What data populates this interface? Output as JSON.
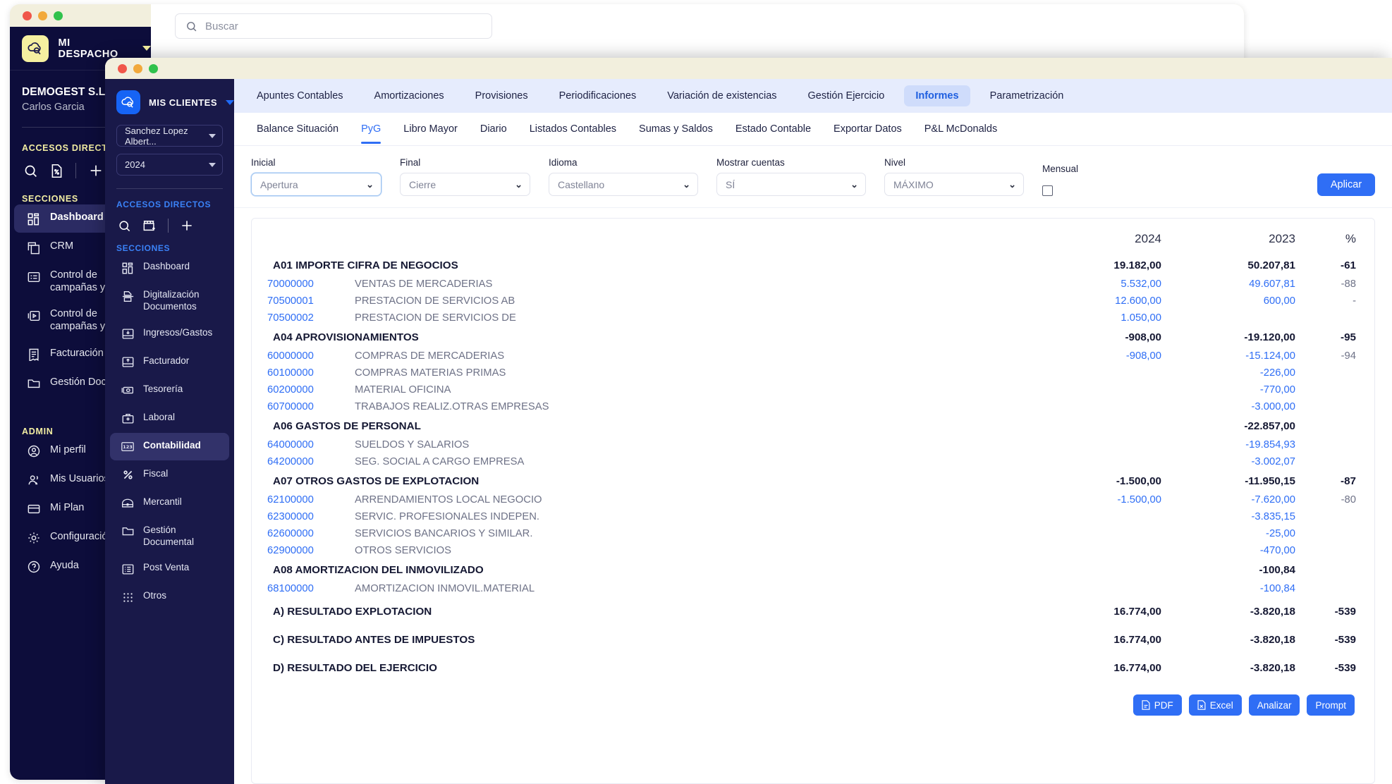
{
  "back_window": {
    "brand": {
      "name": "MI DESPACHO",
      "logo_icon": "cloud-search-icon",
      "caret_icon": "chevron-down-icon"
    },
    "search": {
      "placeholder": "Buscar",
      "icon": "search-icon"
    },
    "org": {
      "name": "DEMOGEST S.L",
      "user": "Carlos Garcia"
    },
    "shortcuts": {
      "title": "ACCESOS DIRECTOS",
      "icons": [
        "search-icon",
        "document-percent-icon",
        "plus-icon"
      ]
    },
    "sections": {
      "title": "SECCIONES",
      "items": [
        {
          "label": "Dashboard",
          "icon": "dashboard-icon",
          "active": true
        },
        {
          "label": "CRM",
          "icon": "copy-icon",
          "active": false
        },
        {
          "label": "Control de campañas y NE",
          "icon": "window-list-icon",
          "active": false
        },
        {
          "label": "Control de campañas y NE",
          "icon": "media-box-icon",
          "active": false
        },
        {
          "label": "Facturación",
          "icon": "invoice-icon",
          "active": false
        },
        {
          "label": "Gestión Docum",
          "icon": "folder-icon",
          "active": false
        }
      ]
    },
    "admin": {
      "title": "ADMIN",
      "items": [
        {
          "label": "Mi perfil",
          "icon": "user-circle-icon"
        },
        {
          "label": "Mis Usuarios",
          "icon": "users-icon"
        },
        {
          "label": "Mi Plan",
          "icon": "card-icon"
        },
        {
          "label": "Configuración",
          "icon": "gear-icon"
        },
        {
          "label": "Ayuda",
          "icon": "help-circle-icon"
        }
      ]
    }
  },
  "front_window": {
    "sidebar": {
      "brand": {
        "name": "MIS CLIENTES",
        "logo_icon": "cloud-search-icon",
        "caret_icon": "chevron-down-icon"
      },
      "client_select": {
        "value": "Sanchez Lopez Albert...",
        "caret_icon": "chevron-down-icon"
      },
      "year_select": {
        "value": "2024",
        "caret_icon": "chevron-down-icon"
      },
      "shortcuts": {
        "title": "ACCESOS DIRECTOS",
        "icons": [
          "search-icon",
          "store-add-icon",
          "plus-icon"
        ]
      },
      "sections": {
        "title": "SECCIONES",
        "items": [
          {
            "label": "Dashboard",
            "icon": "dashboard-icon",
            "active": false
          },
          {
            "label": "Digitalización Documentos",
            "icon": "scan-doc-icon",
            "active": false
          },
          {
            "label": "Ingresos/Gastos",
            "icon": "inbox-down-icon",
            "active": false
          },
          {
            "label": "Facturador",
            "icon": "inbox-up-icon",
            "active": false
          },
          {
            "label": "Tesorería",
            "icon": "money-icon",
            "active": false
          },
          {
            "label": "Laboral",
            "icon": "briefcase-icon",
            "active": false
          },
          {
            "label": "Contabilidad",
            "icon": "numbers-123-icon",
            "active": true
          },
          {
            "label": "Fiscal",
            "icon": "percent-icon",
            "active": false
          },
          {
            "label": "Mercantil",
            "icon": "toolbox-icon",
            "active": false
          },
          {
            "label": "Gestión Documental",
            "icon": "folder-icon",
            "active": false
          },
          {
            "label": "Post Venta",
            "icon": "list-box-icon",
            "active": false
          },
          {
            "label": "Otros",
            "icon": "grid-dots-icon",
            "active": false
          }
        ]
      }
    },
    "topnav": {
      "tabs": [
        {
          "label": "Apuntes Contables",
          "active": false
        },
        {
          "label": "Amortizaciones",
          "active": false
        },
        {
          "label": "Provisiones",
          "active": false
        },
        {
          "label": "Periodificaciones",
          "active": false
        },
        {
          "label": "Variación de existencias",
          "active": false
        },
        {
          "label": "Gestión Ejercicio",
          "active": false
        },
        {
          "label": "Informes",
          "active": true
        },
        {
          "label": "Parametrización",
          "active": false
        }
      ]
    },
    "subnav": {
      "tabs": [
        {
          "label": "Balance Situación",
          "active": false
        },
        {
          "label": "PyG",
          "active": true
        },
        {
          "label": "Libro Mayor",
          "active": false
        },
        {
          "label": "Diario",
          "active": false
        },
        {
          "label": "Listados Contables",
          "active": false
        },
        {
          "label": "Sumas y Saldos",
          "active": false
        },
        {
          "label": "Estado Contable",
          "active": false
        },
        {
          "label": "Exportar Datos",
          "active": false
        },
        {
          "label": "P&L McDonalds",
          "active": false
        }
      ]
    },
    "filters": {
      "inicial": {
        "label": "Inicial",
        "value": "Apertura"
      },
      "final": {
        "label": "Final",
        "value": "Cierre"
      },
      "idioma": {
        "label": "Idioma",
        "value": "Castellano"
      },
      "mostrar_cuentas": {
        "label": "Mostrar cuentas",
        "value": "SÍ"
      },
      "nivel": {
        "label": "Nivel",
        "value": "MÁXIMO"
      },
      "mensual": {
        "label": "Mensual",
        "checked": false
      },
      "apply_label": "Aplicar"
    },
    "report": {
      "columns": {
        "code": "",
        "desc": "",
        "y1": "2024",
        "y2": "2023",
        "pct": "%"
      },
      "rows": [
        {
          "type": "group",
          "code": "A01",
          "desc": "IMPORTE CIFRA DE NEGOCIOS",
          "y1": "19.182,00",
          "y2": "50.207,81",
          "pct": "-61"
        },
        {
          "type": "detail",
          "code": "70000000",
          "desc": "VENTAS DE MERCADERIAS",
          "y1": "5.532,00",
          "y2": "49.607,81",
          "pct": "-88"
        },
        {
          "type": "detail",
          "code": "70500001",
          "desc": "PRESTACION DE SERVICIOS AB",
          "y1": "12.600,00",
          "y2": "600,00",
          "pct": "-"
        },
        {
          "type": "detail",
          "code": "70500002",
          "desc": "PRESTACION DE SERVICIOS DE",
          "y1": "1.050,00",
          "y2": "",
          "pct": ""
        },
        {
          "type": "group",
          "code": "A04",
          "desc": "APROVISIONAMIENTOS",
          "y1": "-908,00",
          "y2": "-19.120,00",
          "pct": "-95"
        },
        {
          "type": "detail",
          "code": "60000000",
          "desc": "COMPRAS DE MERCADERIAS",
          "y1": "-908,00",
          "y2": "-15.124,00",
          "pct": "-94"
        },
        {
          "type": "detail",
          "code": "60100000",
          "desc": "COMPRAS MATERIAS PRIMAS",
          "y1": "",
          "y2": "-226,00",
          "pct": ""
        },
        {
          "type": "detail",
          "code": "60200000",
          "desc": "MATERIAL OFICINA",
          "y1": "",
          "y2": "-770,00",
          "pct": ""
        },
        {
          "type": "detail",
          "code": "60700000",
          "desc": "TRABAJOS REALIZ.OTRAS EMPRESAS",
          "y1": "",
          "y2": "-3.000,00",
          "pct": ""
        },
        {
          "type": "group",
          "code": "A06",
          "desc": "GASTOS DE PERSONAL",
          "y1": "",
          "y2": "-22.857,00",
          "pct": ""
        },
        {
          "type": "detail",
          "code": "64000000",
          "desc": "SUELDOS Y SALARIOS",
          "y1": "",
          "y2": "-19.854,93",
          "pct": ""
        },
        {
          "type": "detail",
          "code": "64200000",
          "desc": "SEG. SOCIAL A CARGO EMPRESA",
          "y1": "",
          "y2": "-3.002,07",
          "pct": ""
        },
        {
          "type": "group",
          "code": "A07",
          "desc": "OTROS GASTOS DE EXPLOTACION",
          "y1": "-1.500,00",
          "y2": "-11.950,15",
          "pct": "-87"
        },
        {
          "type": "detail",
          "code": "62100000",
          "desc": "ARRENDAMIENTOS LOCAL NEGOCIO",
          "y1": "-1.500,00",
          "y2": "-7.620,00",
          "pct": "-80"
        },
        {
          "type": "detail",
          "code": "62300000",
          "desc": "SERVIC. PROFESIONALES INDEPEN.",
          "y1": "",
          "y2": "-3.835,15",
          "pct": ""
        },
        {
          "type": "detail",
          "code": "62600000",
          "desc": "SERVICIOS BANCARIOS Y SIMILAR.",
          "y1": "",
          "y2": "-25,00",
          "pct": ""
        },
        {
          "type": "detail",
          "code": "62900000",
          "desc": "OTROS SERVICIOS",
          "y1": "",
          "y2": "-470,00",
          "pct": ""
        },
        {
          "type": "group",
          "code": "A08",
          "desc": "AMORTIZACION DEL INMOVILIZADO",
          "y1": "",
          "y2": "-100,84",
          "pct": ""
        },
        {
          "type": "detail",
          "code": "68100000",
          "desc": "AMORTIZACION INMOVIL.MATERIAL",
          "y1": "",
          "y2": "-100,84",
          "pct": ""
        },
        {
          "type": "total",
          "code": "A)",
          "desc": "RESULTADO EXPLOTACION",
          "y1": "16.774,00",
          "y2": "-3.820,18",
          "pct": "-539"
        },
        {
          "type": "total",
          "code": "C)",
          "desc": "RESULTADO ANTES DE IMPUESTOS",
          "y1": "16.774,00",
          "y2": "-3.820,18",
          "pct": "-539"
        },
        {
          "type": "total",
          "code": "D)",
          "desc": "RESULTADO DEL EJERCICIO",
          "y1": "16.774,00",
          "y2": "-3.820,18",
          "pct": "-539"
        }
      ],
      "footer_buttons": [
        {
          "label": "PDF",
          "icon": "pdf-file-icon"
        },
        {
          "label": "Excel",
          "icon": "excel-file-icon"
        },
        {
          "label": "Analizar",
          "icon": ""
        },
        {
          "label": "Prompt",
          "icon": ""
        }
      ]
    }
  },
  "colors": {
    "accent_blue": "#2f6ef5",
    "sidebar_dark": "#0d0d3b",
    "front_sidebar": "#191949",
    "topnav_bg": "#e6ecfd",
    "titlebar_cream": "#f2efdd"
  }
}
